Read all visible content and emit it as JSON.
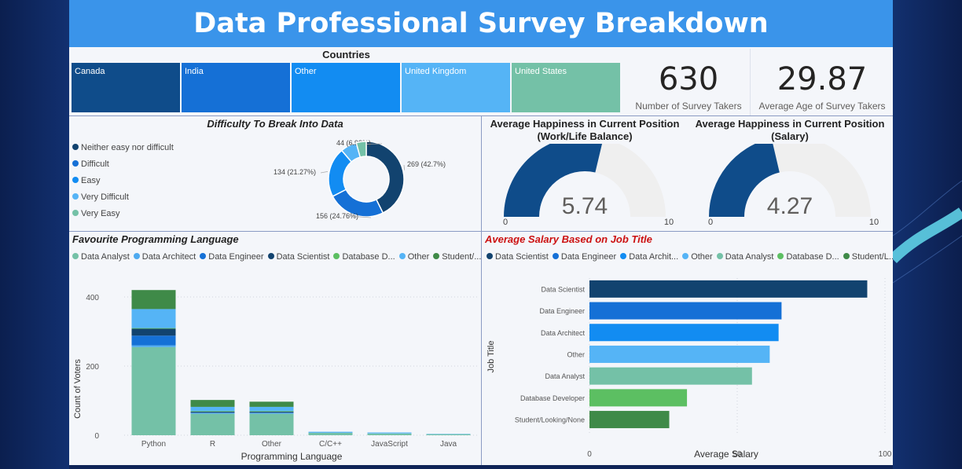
{
  "dashboard_title": "Data Professional Survey Breakdown",
  "countries": {
    "title": "Countries",
    "tiles": [
      {
        "label": "Canada",
        "color": "#0f4c8a"
      },
      {
        "label": "India",
        "color": "#1570d6"
      },
      {
        "label": "Other",
        "color": "#128cf2"
      },
      {
        "label": "United Kingdom",
        "color": "#55b4f6"
      },
      {
        "label": "United States",
        "color": "#74c1a7"
      }
    ]
  },
  "kpis": {
    "survey_takers": {
      "value": "630",
      "label": "Number of Survey Takers"
    },
    "average_age": {
      "value": "29.87",
      "label": "Average Age of Survey Takers"
    }
  },
  "colors": {
    "data_analyst": "#74c1a7",
    "data_architect": "#4eaaf0",
    "data_engineer": "#1570d6",
    "data_scientist": "#12436f",
    "database_developer": "#5cbf62",
    "other": "#55b4f6",
    "student": "#3f8a48",
    "gauge_fill": "#0f4c8a",
    "gauge_track": "#efefef",
    "accent_red": "#cc1111"
  },
  "chart_data": [
    {
      "type": "pie",
      "title": "Difficulty To Break Into Data",
      "legend": [
        "Neither easy nor difficult",
        "Difficult",
        "Easy",
        "Very Difficult",
        "Very Easy"
      ],
      "legend_colors": [
        "#12436f",
        "#1570d6",
        "#128cf2",
        "#55b4f6",
        "#74c1a7"
      ],
      "slices": [
        {
          "name": "Neither easy nor difficult",
          "value": 269,
          "label": "269 (42.7%)",
          "color": "#12436f"
        },
        {
          "name": "Difficult",
          "value": 156,
          "label": "156 (24.76%)",
          "color": "#1570d6"
        },
        {
          "name": "Easy",
          "value": 134,
          "label": "134 (21.27%)",
          "color": "#128cf2"
        },
        {
          "name": "Very Difficult",
          "value": 44,
          "label": "44 (6.98%)",
          "color": "#55b4f6"
        },
        {
          "name": "Very Easy",
          "value": 27,
          "label": "",
          "color": "#74c1a7"
        }
      ]
    },
    {
      "type": "gauge",
      "title_line1": "Average Happiness in Current Position",
      "title_line2": "(Work/Life Balance)",
      "value": 5.74,
      "value_label": "5.74",
      "min": 0,
      "max": 10,
      "min_label": "0",
      "max_label": "10"
    },
    {
      "type": "gauge",
      "title_line1": "Average Happiness in Current Position",
      "title_line2": "(Salary)",
      "value": 4.27,
      "value_label": "4.27",
      "min": 0,
      "max": 10,
      "min_label": "0",
      "max_label": "10"
    },
    {
      "type": "bar",
      "stacked": true,
      "title": "Favourite Programming Language",
      "legend": [
        "Data Analyst",
        "Data Architect",
        "Data Engineer",
        "Data Scientist",
        "Database D...",
        "Other",
        "Student/..."
      ],
      "legend_colors": [
        "#74c1a7",
        "#4eaaf0",
        "#1570d6",
        "#12436f",
        "#5cbf62",
        "#55b4f6",
        "#3f8a48"
      ],
      "categories": [
        "Python",
        "R",
        "Other",
        "C/C++",
        "JavaScript",
        "Java"
      ],
      "series": [
        {
          "name": "Data Analyst",
          "color": "#74c1a7",
          "values": [
            255,
            62,
            62,
            7,
            5,
            3
          ]
        },
        {
          "name": "Data Architect",
          "color": "#4eaaf0",
          "values": [
            5,
            3,
            3,
            1,
            1,
            0
          ]
        },
        {
          "name": "Data Engineer",
          "color": "#1570d6",
          "values": [
            28,
            0,
            0,
            0,
            0,
            0
          ]
        },
        {
          "name": "Data Scientist",
          "color": "#12436f",
          "values": [
            20,
            3,
            3,
            0,
            0,
            0
          ]
        },
        {
          "name": "Database D...",
          "color": "#5cbf62",
          "values": [
            2,
            2,
            2,
            0,
            0,
            0
          ]
        },
        {
          "name": "Other",
          "color": "#55b4f6",
          "values": [
            55,
            12,
            12,
            2,
            2,
            1
          ]
        },
        {
          "name": "Student/...",
          "color": "#3f8a48",
          "values": [
            55,
            20,
            15,
            0,
            0,
            0
          ]
        }
      ],
      "xlabel": "Programming Language",
      "ylabel": "Count of Voters",
      "ylim": [
        0,
        450
      ],
      "yticks": [
        0,
        200,
        400
      ]
    },
    {
      "type": "bar",
      "orientation": "horizontal",
      "title": "Average Salary Based on Job Title",
      "legend": [
        "Data Scientist",
        "Data Engineer",
        "Data Archit...",
        "Other",
        "Data Analyst",
        "Database D...",
        "Student/L..."
      ],
      "legend_colors": [
        "#12436f",
        "#1570d6",
        "#128cf2",
        "#55b4f6",
        "#74c1a7",
        "#5cbf62",
        "#3f8a48"
      ],
      "categories": [
        "Data Scientist",
        "Data Engineer",
        "Data Architect",
        "Other",
        "Data Analyst",
        "Database Developer",
        "Student/Looking/None"
      ],
      "values": [
        94,
        65,
        64,
        61,
        55,
        33,
        27
      ],
      "colors": [
        "#12436f",
        "#1570d6",
        "#128cf2",
        "#55b4f6",
        "#74c1a7",
        "#5cbf62",
        "#3f8a48"
      ],
      "xlabel": "Average Salary",
      "ylabel": "Job Title",
      "xlim": [
        0,
        100
      ],
      "xticks": [
        0,
        50,
        100
      ]
    }
  ]
}
